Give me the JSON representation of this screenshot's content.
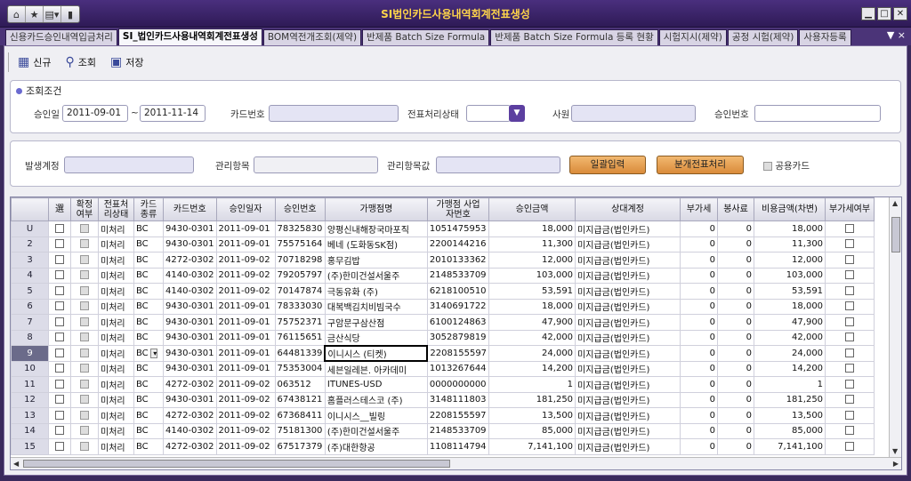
{
  "window": {
    "title": "SI법인카드사용내역회계전표생성"
  },
  "tabs": [
    "신용카드승인내역입금처리",
    "SI_법인카드사용내역회계전표생성",
    "BOM역전개조회(제약)",
    "반제품 Batch Size Formula",
    "반제품 Batch Size Formula 등록 현황",
    "시험지시(제약)",
    "공정 시험(제약)",
    "사용자등록"
  ],
  "tab_controls": "▼ ×",
  "toolbar": {
    "new": "신규",
    "search": "조회",
    "save": "저장"
  },
  "criteria": {
    "title": "조회조건",
    "approve_date_label": "승인일",
    "date_from": "2011-09-01",
    "date_sep": "~",
    "date_to": "2011-11-14",
    "card_no_label": "카드번호",
    "slip_status_label": "전표처리상태",
    "employee_label": "사원",
    "approve_no_label": "승인번호"
  },
  "issue": {
    "account_label": "발생계정",
    "mgmt_item_label": "관리항목",
    "mgmt_value_label": "관리항목값",
    "batch_button": "일괄입력",
    "split_button": "분개전표처리",
    "shared_card_label": "공용카드"
  },
  "grid": {
    "headers": [
      "",
      "選",
      "확정\n여부",
      "전표처\n리상태",
      "카드\n종류",
      "카드번호",
      "승인일자",
      "승인번호",
      "가맹점명",
      "가맹점 사업\n자번호",
      "승인금액",
      "상대계정",
      "부가세",
      "봉사료",
      "비용금액(차변)",
      "부가세여부"
    ],
    "rows": [
      [
        "U",
        "미처리",
        "BC",
        "9430-0301",
        "2011-09-01",
        "78325830",
        "양평신내해장국마포직",
        "1051475953",
        "18,000",
        "미지급금(법인카드)",
        "0",
        "0",
        "18,000"
      ],
      [
        "2",
        "미처리",
        "BC",
        "9430-0301",
        "2011-09-01",
        "75575164",
        "베네 (도화동SK점)",
        "2200144216",
        "11,300",
        "미지급금(법인카드)",
        "0",
        "0",
        "11,300"
      ],
      [
        "3",
        "미처리",
        "BC",
        "4272-0302",
        "2011-09-02",
        "70718298",
        "홍무김밥",
        "2010133362",
        "12,000",
        "미지급금(법인카드)",
        "0",
        "0",
        "12,000"
      ],
      [
        "4",
        "미처리",
        "BC",
        "4140-0302",
        "2011-09-02",
        "79205797",
        "(주)한미건설서울주",
        "2148533709",
        "103,000",
        "미지급금(법인카드)",
        "0",
        "0",
        "103,000"
      ],
      [
        "5",
        "미처리",
        "BC",
        "4140-0302",
        "2011-09-02",
        "70147874",
        "극동유화 (주)",
        "6218100510",
        "53,591",
        "미지급금(법인카드)",
        "0",
        "0",
        "53,591"
      ],
      [
        "6",
        "미처리",
        "BC",
        "9430-0301",
        "2011-09-01",
        "78333030",
        "대복백김치비빔국수",
        "3140691722",
        "18,000",
        "미지급금(법인카드)",
        "0",
        "0",
        "18,000"
      ],
      [
        "7",
        "미처리",
        "BC",
        "9430-0301",
        "2011-09-01",
        "75752371",
        "구암문구삼산점",
        "6100124863",
        "47,900",
        "미지급금(법인카드)",
        "0",
        "0",
        "47,900"
      ],
      [
        "8",
        "미처리",
        "BC",
        "9430-0301",
        "2011-09-01",
        "76115651",
        "금산식당",
        "3052879819",
        "42,000",
        "미지급금(법인카드)",
        "0",
        "0",
        "42,000"
      ],
      [
        "9",
        "미처리",
        "BC",
        "9430-0301",
        "2011-09-01",
        "64481339",
        "이니시스 (티켓)",
        "2208155597",
        "24,000",
        "미지급금(법인카드)",
        "0",
        "0",
        "24,000"
      ],
      [
        "10",
        "미처리",
        "BC",
        "9430-0301",
        "2011-09-01",
        "75353004",
        "세븐일레븐. 아카데미",
        "1013267644",
        "14,200",
        "미지급금(법인카드)",
        "0",
        "0",
        "14,200"
      ],
      [
        "11",
        "미처리",
        "BC",
        "4272-0302",
        "2011-09-02",
        "063512",
        "ITUNES-USD",
        "0000000000",
        "1",
        "미지급금(법인카드)",
        "0",
        "0",
        "1"
      ],
      [
        "12",
        "미처리",
        "BC",
        "9430-0301",
        "2011-09-02",
        "67438121",
        "홈플러스테스코 (주)",
        "3148111803",
        "181,250",
        "미지급금(법인카드)",
        "0",
        "0",
        "181,250"
      ],
      [
        "13",
        "미처리",
        "BC",
        "4272-0302",
        "2011-09-02",
        "67368411",
        "이니시스__빌링",
        "2208155597",
        "13,500",
        "미지급금(법인카드)",
        "0",
        "0",
        "13,500"
      ],
      [
        "14",
        "미처리",
        "BC",
        "4140-0302",
        "2011-09-02",
        "75181300",
        "(주)한미건설서울주",
        "2148533709",
        "85,000",
        "미지급금(법인카드)",
        "0",
        "0",
        "85,000"
      ],
      [
        "15",
        "미처리",
        "BC",
        "4272-0302",
        "2011-09-02",
        "67517379",
        "(주)대한항공",
        "1108114794",
        "7,141,100",
        "미지급금(법인카드)",
        "0",
        "0",
        "7,141,100"
      ]
    ],
    "selected_row": "9"
  },
  "colors": {
    "title": "#ffd54a",
    "accent": "#5c3fa0",
    "button": "#e5a050"
  }
}
